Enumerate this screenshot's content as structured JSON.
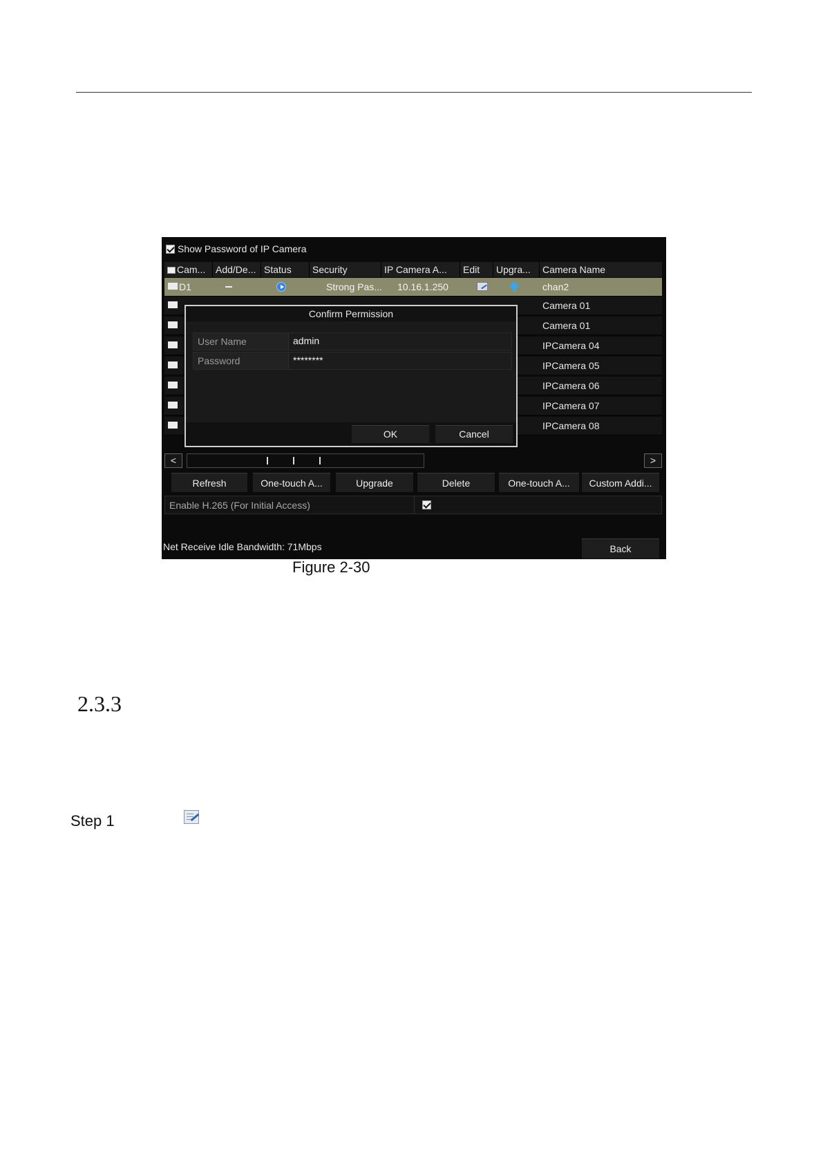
{
  "screenshot": {
    "show_password_label": "Show Password of IP Camera",
    "columns": [
      "Cam...",
      "Add/De...",
      "Status",
      "Security",
      "IP Camera A...",
      "Edit",
      "Upgra...",
      "Camera Name"
    ],
    "first_row": {
      "id": "D1",
      "security": "Strong Pas...",
      "ip": "10.16.1.250",
      "camera_name": "chan2"
    },
    "other_camera_names": [
      "Camera 01",
      "Camera 01",
      "IPCamera 04",
      "IPCamera 05",
      "IPCamera 06",
      "IPCamera 07",
      "IPCamera 08"
    ],
    "dialog": {
      "title": "Confirm Permission",
      "username_label": "User Name",
      "username_value": "admin",
      "password_label": "Password",
      "password_value": "********",
      "ok_label": "OK",
      "cancel_label": "Cancel"
    },
    "buttons": [
      "Refresh",
      "One-touch A...",
      "Upgrade",
      "Delete",
      "One-touch A...",
      "Custom Addi..."
    ],
    "h265_label": "Enable H.265 (For Initial Access)",
    "bandwidth_text": "Net Receive Idle Bandwidth: 71Mbps",
    "back_label": "Back",
    "scroll_left": "<",
    "scroll_right": ">"
  },
  "caption": "Figure 2-30",
  "section_number": "2.3.3",
  "step_label": "Step 1"
}
